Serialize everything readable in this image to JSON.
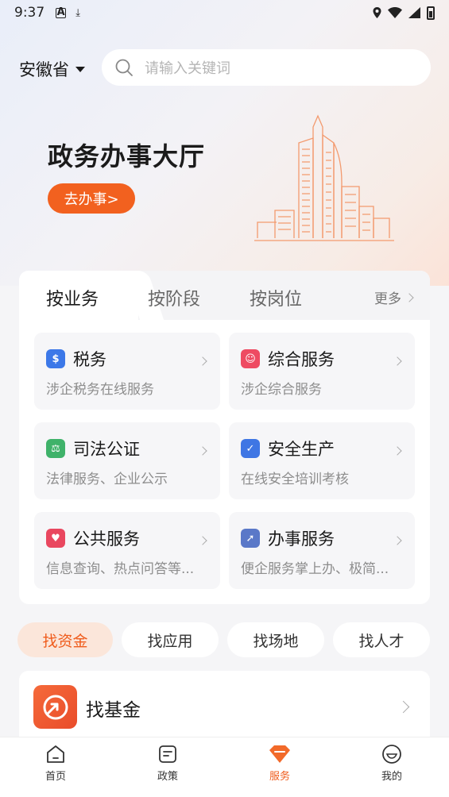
{
  "status_bar": {
    "time": "9:37"
  },
  "header": {
    "province": "安徽省",
    "search_placeholder": "请输入关键词"
  },
  "hero": {
    "title": "政务办事大厅",
    "button": "去办事>"
  },
  "service_card": {
    "tabs": [
      {
        "label": "按业务",
        "active": true
      },
      {
        "label": "按阶段",
        "active": false
      },
      {
        "label": "按岗位",
        "active": false
      }
    ],
    "more": "更多",
    "items": [
      {
        "name": "税务",
        "desc": "涉企税务在线服务",
        "icon": "tax-icon",
        "color": "#3c78e8"
      },
      {
        "name": "综合服务",
        "desc": "涉企综合服务",
        "icon": "people-icon",
        "color": "#ee4b62"
      },
      {
        "name": "司法公证",
        "desc": "法律服务、企业公示",
        "icon": "gavel-icon",
        "color": "#3fb26a"
      },
      {
        "name": "安全生产",
        "desc": "在线安全培训考核",
        "icon": "shield-icon",
        "color": "#3f76e4"
      },
      {
        "name": "公共服务",
        "desc": "信息查询、热点问答等...",
        "icon": "heart-icon",
        "color": "#e9475f"
      },
      {
        "name": "办事服务",
        "desc": "便企服务掌上办、极简...",
        "icon": "compass-icon",
        "color": "#5a78c8"
      }
    ]
  },
  "find_tabs": [
    {
      "label": "找资金",
      "active": true
    },
    {
      "label": "找应用",
      "active": false
    },
    {
      "label": "找场地",
      "active": false
    },
    {
      "label": "找人才",
      "active": false
    }
  ],
  "fund": {
    "name": "找基金"
  },
  "bottom_nav": [
    {
      "label": "首页",
      "icon": "home-icon",
      "active": false
    },
    {
      "label": "政策",
      "icon": "policy-icon",
      "active": false
    },
    {
      "label": "服务",
      "icon": "service-icon",
      "active": true
    },
    {
      "label": "我的",
      "icon": "profile-icon",
      "active": false
    }
  ],
  "colors": {
    "accent": "#ef5c1c",
    "hero_button": "#f2611f"
  }
}
